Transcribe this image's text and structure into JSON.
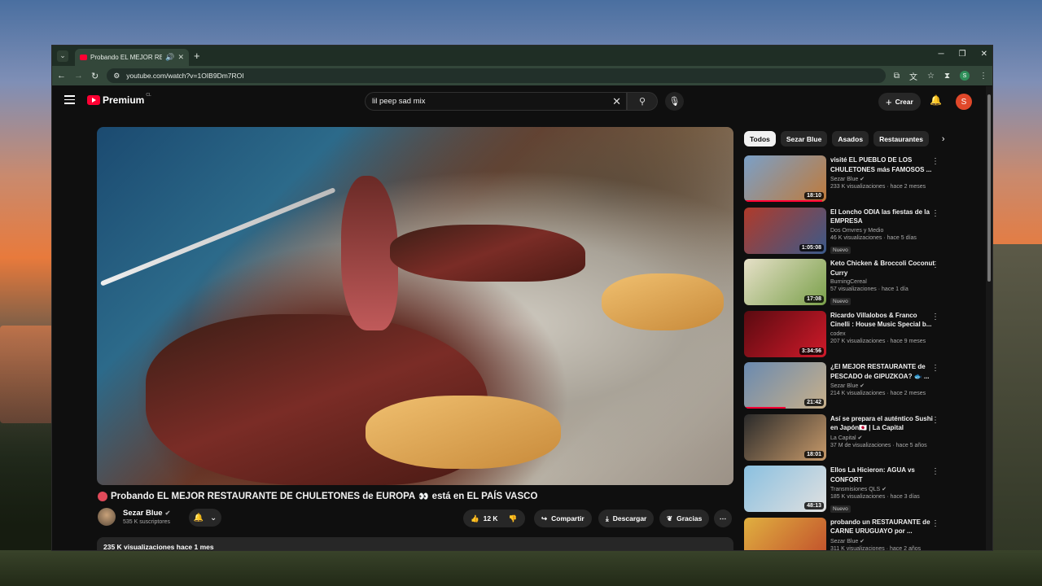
{
  "browser": {
    "tab_title": "Probando EL MEJOR RE",
    "url": "youtube.com/watch?v=1OIB9Dm7ROI"
  },
  "youtube": {
    "logo_text": "Premium",
    "logo_country": "CL",
    "search_query": "lil peep sad mix",
    "create_label": "Crear",
    "user_initial": "S"
  },
  "video": {
    "title": "Probando EL MEJOR RESTAURANTE DE CHULETONES de EUROPA",
    "title_suffix": "está en EL PAÍS VASCO",
    "channel": "Sezar Blue",
    "subscribers": "535 K suscriptores",
    "likes": "12 K",
    "share_label": "Compartir",
    "download_label": "Descargar",
    "thanks_label": "Gracias",
    "views_date": "235 K visualizaciones  hace 1 mes"
  },
  "chips": [
    "Todos",
    "Sezar Blue",
    "Asados",
    "Restaurantes"
  ],
  "recommendations": [
    {
      "title": "visité EL PUEBLO DE LOS CHULETONES más FAMOSOS ...",
      "channel": "Sezar Blue",
      "verified": true,
      "meta": "233 K visualizaciones · hace 2 meses",
      "duration": "18:10",
      "badge": "",
      "progress": 0.95,
      "colors": [
        "#7aa0c8",
        "#c07a3a"
      ]
    },
    {
      "title": "El Loncho ODIA las fiestas de la EMPRESA",
      "channel": "Dos Omvres y Medio",
      "verified": false,
      "meta": "46 K visualizaciones · hace 5 días",
      "duration": "1:05:08",
      "badge": "Nuevo",
      "progress": 0,
      "colors": [
        "#b03a2a",
        "#3a5a8a"
      ]
    },
    {
      "title": "Keto Chicken & Broccoli Coconut Curry",
      "channel": "BurningCereal",
      "verified": false,
      "meta": "57 visualizaciones · hace 1 día",
      "duration": "17:08",
      "badge": "Nuevo",
      "progress": 0,
      "colors": [
        "#e6e0c8",
        "#7aa04a"
      ]
    },
    {
      "title": "Ricardo Villalobos & Franco Cinelli : House Music Special b...",
      "channel": "codex",
      "verified": false,
      "meta": "207 K visualizaciones · hace 9 meses",
      "duration": "3:34:56",
      "badge": "",
      "progress": 0,
      "colors": [
        "#5a0a10",
        "#d01a2a"
      ]
    },
    {
      "title": "¿El MEJOR RESTAURANTE de PESCADO de GIPUZKOA? 🐟 ...",
      "channel": "Sezar Blue",
      "verified": true,
      "meta": "214 K visualizaciones · hace 2 meses",
      "duration": "21:42",
      "badge": "",
      "progress": 0.5,
      "colors": [
        "#6a8ab0",
        "#c8b08a"
      ]
    },
    {
      "title": "Así se prepara el auténtico Sushi en Japón🇯🇵 | La Capital",
      "channel": "La Capital",
      "verified": true,
      "meta": "37 M de visualizaciones · hace 5 años",
      "duration": "18:01",
      "badge": "",
      "progress": 0,
      "colors": [
        "#2a2a2a",
        "#c89a6a"
      ]
    },
    {
      "title": "Ellos La Hicieron: AGUA vs CONFORT",
      "channel": "Transmisiones QLS",
      "verified": true,
      "meta": "185 K visualizaciones · hace 3 días",
      "duration": "48:13",
      "badge": "Nuevo",
      "progress": 0,
      "colors": [
        "#8ac0e0",
        "#e0e0e0"
      ]
    },
    {
      "title": "probando un RESTAURANTE de CARNE URUGUAYO por ...",
      "channel": "Sezar Blue",
      "verified": true,
      "meta": "311 K visualizaciones · hace 2 años",
      "duration": "",
      "badge": "",
      "progress": 0,
      "colors": [
        "#e0b040",
        "#c04a2a"
      ]
    }
  ],
  "icons": {
    "back": "arrow-left-icon",
    "forward": "arrow-right-icon",
    "reload": "reload-icon",
    "search": "search-icon",
    "mic": "mic-icon",
    "bell": "bell-icon"
  }
}
